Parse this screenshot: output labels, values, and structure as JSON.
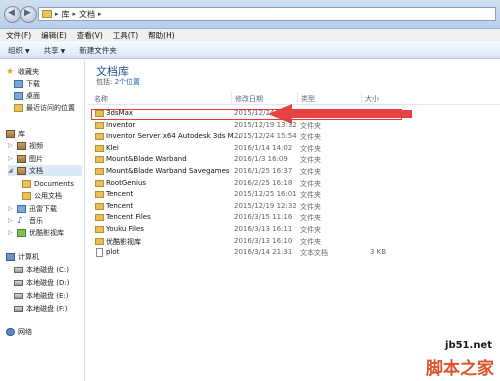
{
  "address": {
    "segments": [
      "库",
      "文档"
    ]
  },
  "menu": [
    "文件(F)",
    "编辑(E)",
    "查看(V)",
    "工具(T)",
    "帮助(H)"
  ],
  "toolbar": {
    "organize": "组织",
    "share": "共享",
    "new_folder": "新建文件夹"
  },
  "sidebar": {
    "favorites": "收藏夹",
    "fav_items": [
      "下载",
      "桌面",
      "最近访问的位置"
    ],
    "libraries": "库",
    "lib_items": [
      "视频",
      "图片",
      "文档"
    ],
    "doc_subitems": [
      "Documents",
      "公用文档"
    ],
    "other_lib": [
      "迅雷下载",
      "音乐",
      "优酷影视库"
    ],
    "computer": "计算机",
    "drives": [
      "本地磁盘 (C:)",
      "本地磁盘 (D:)",
      "本地磁盘 (E:)",
      "本地磁盘 (F:)"
    ],
    "network": "网络"
  },
  "library": {
    "title": "文档库",
    "subtitle_prefix": "包括:",
    "subtitle_link": "2个位置"
  },
  "columns": {
    "name": "名称",
    "date": "修改日期",
    "type": "类型",
    "size": "大小"
  },
  "files": [
    {
      "name": "3dsMax",
      "date": "2015/12/24",
      "type": "",
      "size": "",
      "icon": "folder"
    },
    {
      "name": "Inventor",
      "date": "2015/12/19 13:32",
      "type": "文件夹",
      "size": "",
      "icon": "folder"
    },
    {
      "name": "Inventor Server x64 Autodesk 3ds M...",
      "date": "2015/12/24 15:54",
      "type": "文件夹",
      "size": "",
      "icon": "folder"
    },
    {
      "name": "Klei",
      "date": "2016/1/14 14:02",
      "type": "文件夹",
      "size": "",
      "icon": "folder"
    },
    {
      "name": "Mount&Blade Warband",
      "date": "2016/1/3 16:09",
      "type": "文件夹",
      "size": "",
      "icon": "folder"
    },
    {
      "name": "Mount&Blade Warband Savegames",
      "date": "2016/1/25 16:37",
      "type": "文件夹",
      "size": "",
      "icon": "folder"
    },
    {
      "name": "RootGenius",
      "date": "2016/2/25 16:18",
      "type": "文件夹",
      "size": "",
      "icon": "folder"
    },
    {
      "name": "Tencent",
      "date": "2015/12/25 16:01",
      "type": "文件夹",
      "size": "",
      "icon": "folder"
    },
    {
      "name": "Tencent",
      "date": "2015/12/19 12:32",
      "type": "文件夹",
      "size": "",
      "icon": "folder"
    },
    {
      "name": "Tencent Files",
      "date": "2016/3/15 11:16",
      "type": "文件夹",
      "size": "",
      "icon": "folder"
    },
    {
      "name": "Youku Files",
      "date": "2016/3/13 16:11",
      "type": "文件夹",
      "size": "",
      "icon": "folder"
    },
    {
      "name": "优酷影视库",
      "date": "2016/3/13 16:10",
      "type": "文件夹",
      "size": "",
      "icon": "folder"
    },
    {
      "name": "plot",
      "date": "2016/3/14 21:31",
      "type": "文本文档",
      "size": "3 KB",
      "icon": "doc"
    }
  ],
  "watermark": {
    "site": "jb51.net",
    "brand": "脚本之家"
  },
  "colors": {
    "annotation_red": "#e53a3a",
    "title_blue": "#1f4e8c"
  }
}
